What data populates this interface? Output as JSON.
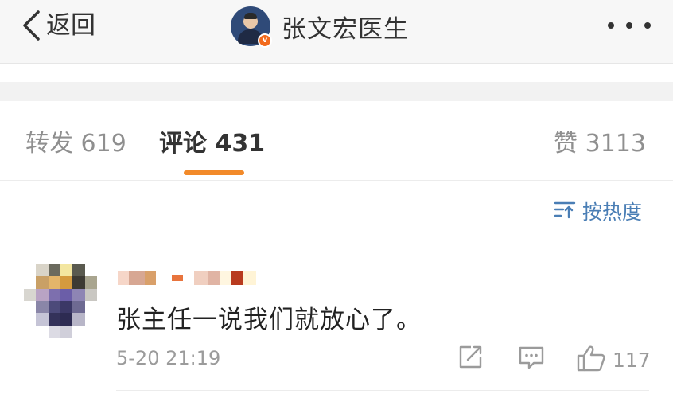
{
  "header": {
    "back_label": "返回",
    "profile_name": "张文宏医生",
    "verified_badge": "v",
    "back_icon": "chevron-left-icon",
    "more_icon": "more-dots-icon"
  },
  "tabs": {
    "repost_label": "转发 619",
    "comment_label": "评论 431",
    "like_label": "赞 3113",
    "active": "comment",
    "accent_color": "#f28a2a"
  },
  "sort": {
    "label": "按热度",
    "icon": "sort-icon",
    "color": "#4a7eb5"
  },
  "comment": {
    "text": "张主任一说我们就放心了。",
    "time": "5-20 21:19",
    "like_count": "117",
    "avatar": "pixelated-avatar",
    "username": "pixelated-username"
  }
}
